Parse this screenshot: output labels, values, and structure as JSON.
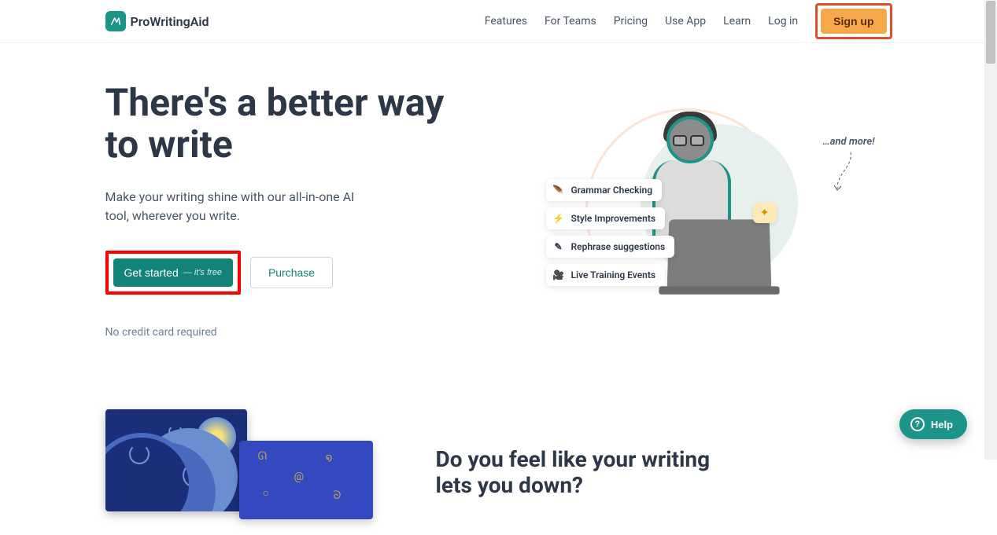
{
  "brand": {
    "name": "ProWritingAid"
  },
  "nav": {
    "features": "Features",
    "for_teams": "For Teams",
    "pricing": "Pricing",
    "use_app": "Use App",
    "learn": "Learn",
    "login": "Log in",
    "signup": "Sign up"
  },
  "hero": {
    "title": "There's a better way to write",
    "subtitle": "Make your writing shine with our all-in-one AI tool, wherever you write.",
    "get_started_label": "Get started",
    "get_started_suffix": "— it's free",
    "purchase_label": "Purchase",
    "no_card": "No credit card required",
    "and_more": "…and more!",
    "chips": {
      "grammar": "Grammar Checking",
      "style": "Style Improvements",
      "rephrase": "Rephrase suggestions",
      "live": "Live Training Events"
    }
  },
  "section2": {
    "title": "Do you feel like your writing lets you down?"
  },
  "help": {
    "label": "Help"
  },
  "colors": {
    "brand_teal": "#1d9488",
    "cta_orange": "#f6a94a",
    "highlight_red": "#ff0000",
    "highlight_orange": "#e04f2a"
  }
}
